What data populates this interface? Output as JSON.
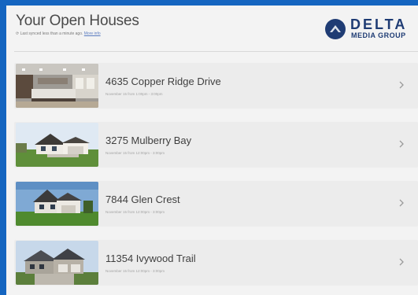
{
  "header": {
    "title": "Your Open Houses",
    "subtitle": "Last synced less than a minute ago.",
    "subtitle_link": "More info"
  },
  "brand": {
    "name": "DELTA",
    "tagline": "MEDIA GROUP",
    "color": "#1f3c74"
  },
  "colors": {
    "frame_border": "#1565c0",
    "background": "#f3f3f3",
    "card": "#ececec"
  },
  "open_houses": [
    {
      "address": "4635 Copper Ridge Drive",
      "time": "November 15 from 1:00pm - 3:00pm",
      "image": "kitchen-interior"
    },
    {
      "address": "3275 Mulberry Bay",
      "time": "November 15 from 12:00pm - 3:00pm",
      "image": "house-exterior"
    },
    {
      "address": "7844 Glen Crest",
      "time": "November 15 from 12:00pm - 3:00pm",
      "image": "house-exterior"
    },
    {
      "address": "11354 Ivywood Trail",
      "time": "November 15 from 12:00pm - 3:00pm",
      "image": "house-exterior"
    }
  ]
}
